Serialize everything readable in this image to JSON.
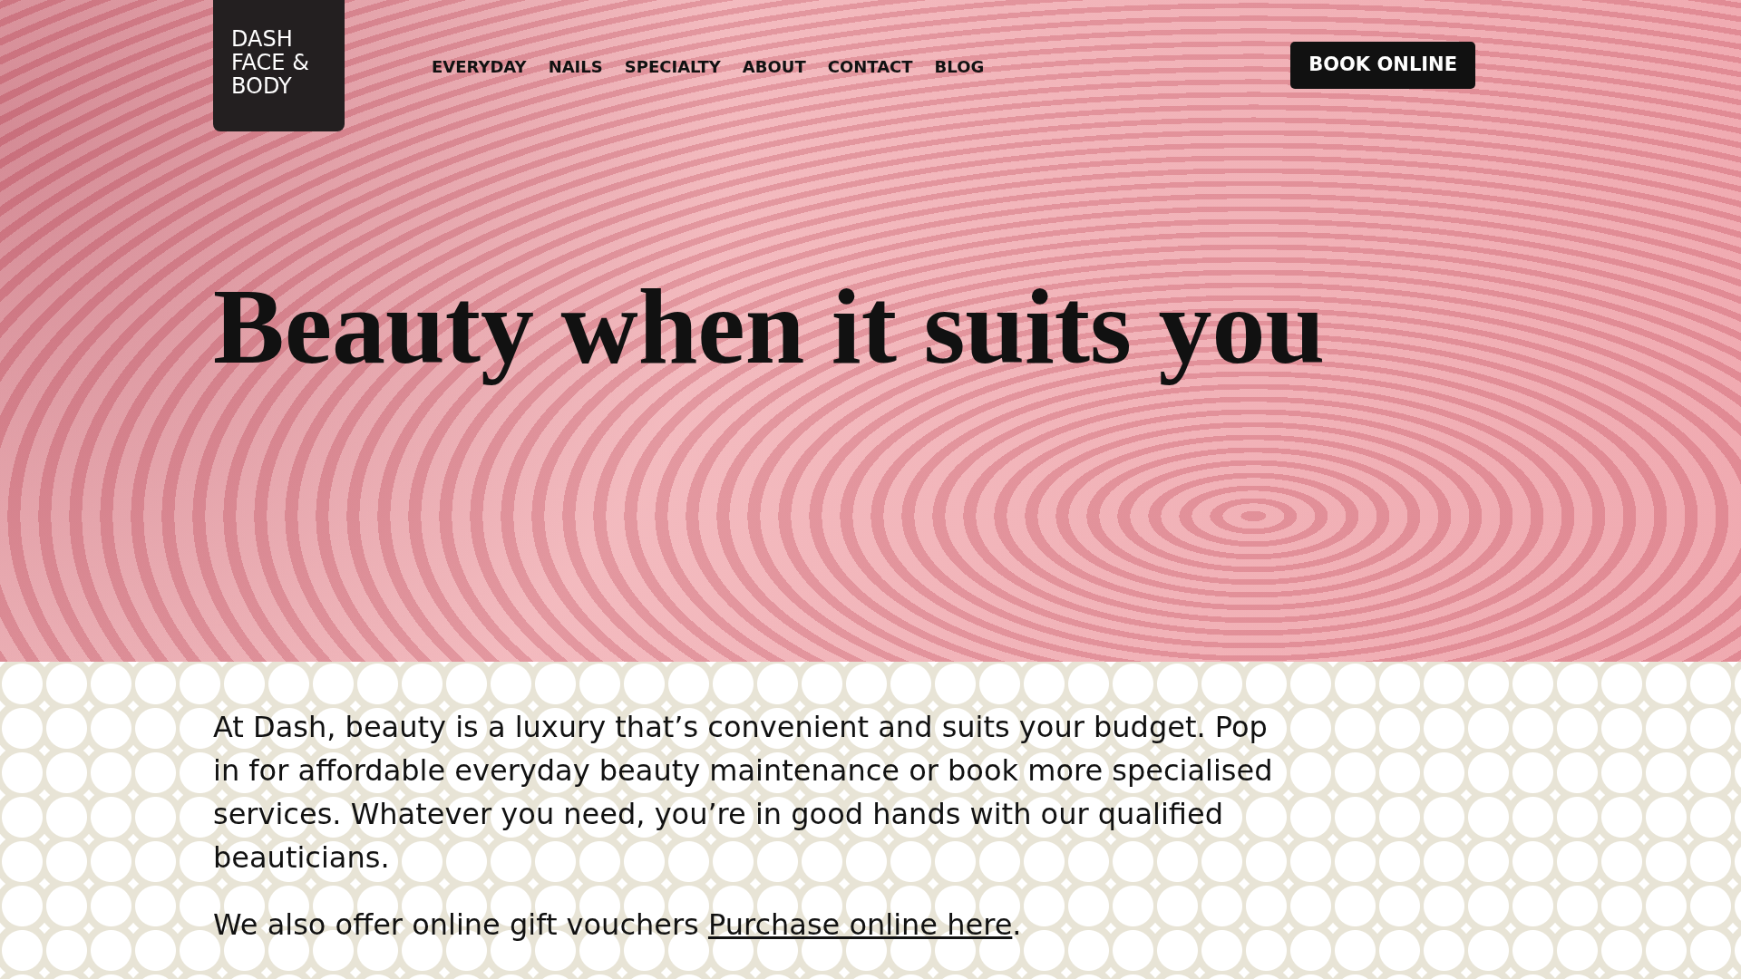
{
  "logo": {
    "lines": [
      "DASH",
      "FACE &",
      "BODY"
    ]
  },
  "nav": [
    {
      "label": "EVERYDAY"
    },
    {
      "label": "NAILS"
    },
    {
      "label": "SPECIALTY"
    },
    {
      "label": "ABOUT"
    },
    {
      "label": "CONTACT"
    },
    {
      "label": "BLOG"
    }
  ],
  "book_button": "BOOK ONLINE",
  "hero": {
    "heading": "Beauty when it suits you"
  },
  "intro": "At Dash, beauty is a luxury that’s convenient and suits your budget. Pop in for affordable everyday beauty maintenance or book more specialised services. Whatever you need, you’re in good hands with our qualified beauticians.",
  "vouchers": {
    "text": "We also offer online gift vouchers ",
    "link": "Purchase online here",
    "after": "."
  }
}
